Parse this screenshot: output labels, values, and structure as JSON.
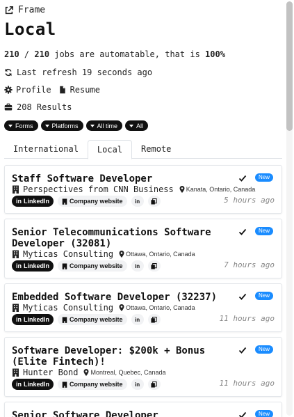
{
  "header": {
    "frame_label": "Frame",
    "title": "Local"
  },
  "stats": {
    "automatable": "210",
    "separator": " / ",
    "total": "210",
    "text_mid": " jobs are automatable, that is ",
    "percent": "100%"
  },
  "refresh": {
    "label": "Last refresh 19 seconds ago"
  },
  "profile": {
    "profile_label": "Profile",
    "resume_label": "Resume"
  },
  "results": {
    "label": "208 Results"
  },
  "filters": [
    {
      "label": "Forms"
    },
    {
      "label": "Platforms"
    },
    {
      "label": "All time"
    },
    {
      "label": "All"
    }
  ],
  "tabs": [
    {
      "label": "International",
      "active": false
    },
    {
      "label": "Local",
      "active": true
    },
    {
      "label": "Remote",
      "active": false
    }
  ],
  "buttons": {
    "linkedin": "LinkedIn",
    "company_website": "Company website",
    "in_short": "in"
  },
  "badge_label": "New",
  "jobs": [
    {
      "title": "Staff Software Developer",
      "company": "Perspectives from CNN Business",
      "location": "Kanata, Ontario, Canada",
      "time": "5 hours ago"
    },
    {
      "title": "Senior Telecommunications Software Developer (32081)",
      "company": "Myticas Consulting",
      "location": "Ottawa, Ontario, Canada",
      "time": "7 hours ago"
    },
    {
      "title": "Embedded Software Developer (32237)",
      "company": "Myticas Consulting",
      "location": "Ottawa, Ontario, Canada",
      "time": "11 hours ago"
    },
    {
      "title": "Software Developer: $200k + Bonus (Elite Fintech)!",
      "company": "Hunter Bond",
      "location": "Montreal, Quebec, Canada",
      "time": "11 hours ago"
    },
    {
      "title": "Senior Software Developer",
      "company": "",
      "location": "",
      "time": ""
    }
  ],
  "colors": {
    "accent_badge": "#1a8cff",
    "chip_bg": "#111111"
  }
}
